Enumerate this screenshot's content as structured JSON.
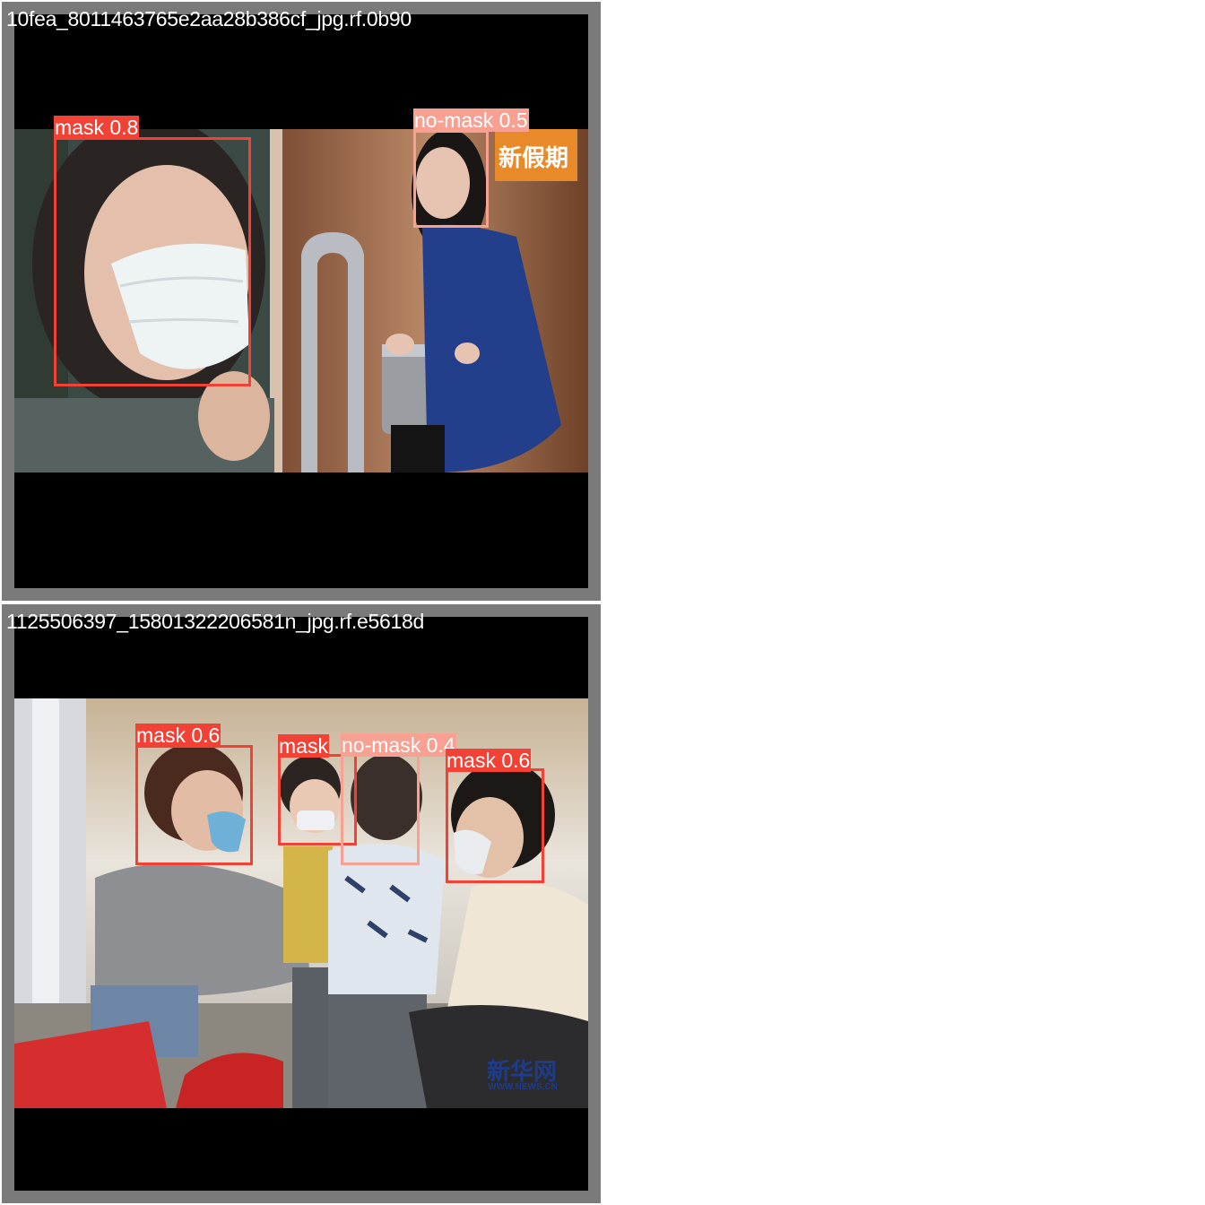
{
  "colors": {
    "mask": "#f24236",
    "no_mask": "#f8a091",
    "frame": "#7a7a7a"
  },
  "tiles": [
    {
      "filename": "10fea_8011463765e2aa28b386cf_jpg.rf.0b90",
      "watermark": "新假期",
      "detections": [
        {
          "label": "mask 0.8",
          "class": "mask"
        },
        {
          "label": "no-mask 0.5",
          "class": "no-mask"
        }
      ]
    },
    {
      "filename": "1125506397_15801322206581n_jpg.rf.e5618d",
      "watermark": "新华网",
      "watermark_sub": "WWW.NEWS.CN",
      "detections": [
        {
          "label": "mask 0.6",
          "class": "mask"
        },
        {
          "label": "mask",
          "class": "mask"
        },
        {
          "label": "no-mask 0.4",
          "class": "no-mask"
        },
        {
          "label": "mask 0.6",
          "class": "mask"
        }
      ]
    }
  ]
}
